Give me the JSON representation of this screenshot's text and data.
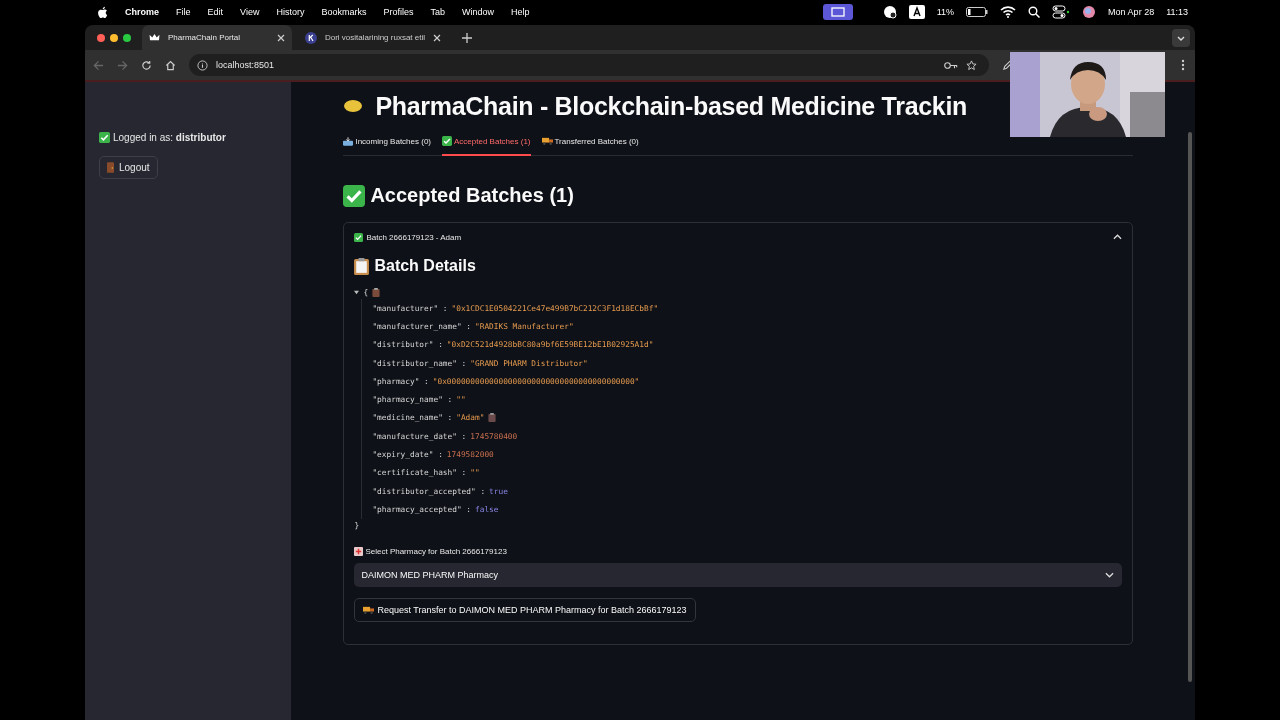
{
  "menu_bar": {
    "app": "Chrome",
    "items": [
      "File",
      "Edit",
      "View",
      "History",
      "Bookmarks",
      "Profiles",
      "Tab",
      "Window",
      "Help"
    ],
    "battery_percent": "11%",
    "date": "Mon Apr 28",
    "time": "11:13"
  },
  "browser": {
    "tabs": [
      {
        "title": "PharmaChain Portal",
        "selected": true
      },
      {
        "title": "Dori vositalarining ruxsat etil",
        "selected": false
      }
    ],
    "address": "localhost:8501"
  },
  "sidebar": {
    "logged_in": "Logged in as: **distributor**",
    "logout": "Logout"
  },
  "main": {
    "title": "PharmaChain - Blockchain-based Medicine Trackin",
    "tabs": [
      {
        "label": "Incoming Batches (0)",
        "selected": false
      },
      {
        "label": "Accepted Batches (1)",
        "selected": true
      },
      {
        "label": "Transferred Batches (0)",
        "selected": false
      }
    ],
    "heading": "Accepted Batches (1)",
    "expander": {
      "label": "Batch 2666179123 - Adam",
      "expanded": true,
      "details_heading": "Batch Details",
      "json_viewer": {
        "open": "{",
        "close": "}",
        "expanded": true,
        "entries": [
          {
            "key": "\"manufacturer\" :",
            "value": "\"0x1CDC1E0504221Ce47e499B7bC212C3F1d18ECbBf\"",
            "kind": "string"
          },
          {
            "key": "\"manufacturer_name\" :",
            "value": "\"RADIKS Manufacturer\"",
            "kind": "string"
          },
          {
            "key": "\"distributor\" :",
            "value": "\"0xD2C521d4928bBC80a9bf6E59BE12bE1B02925A1d\"",
            "kind": "string"
          },
          {
            "key": "\"distributor_name\" :",
            "value": "\"GRAND PHARM Distributor\"",
            "kind": "string"
          },
          {
            "key": "\"pharmacy\" :",
            "value": "\"0x0000000000000000000000000000000000000000\"",
            "kind": "string"
          },
          {
            "key": "\"pharmacy_name\" :",
            "value": "\"\"",
            "kind": "string"
          },
          {
            "key": "\"medicine_name\" :",
            "value": "\"Adam\"",
            "kind": "string",
            "copy_shown": true
          },
          {
            "key": "\"manufacture_date\" :",
            "value": "1745780400",
            "kind": "number"
          },
          {
            "key": "\"expiry_date\" :",
            "value": "1749582000",
            "kind": "number"
          },
          {
            "key": "\"certificate_hash\" :",
            "value": "\"\"",
            "kind": "string"
          },
          {
            "key": "\"distributor_accepted\" :",
            "value": "true",
            "kind": "boolean"
          },
          {
            "key": "\"pharmacy_accepted\" :",
            "value": "false",
            "kind": "boolean"
          }
        ]
      },
      "select_label": "Select Pharmacy for Batch 2666179123",
      "select_value": "DAIMON MED PHARM Pharmacy",
      "transfer_button": "Request Transfer to DAIMON MED PHARM Pharmacy for Batch 2666179123"
    }
  }
}
